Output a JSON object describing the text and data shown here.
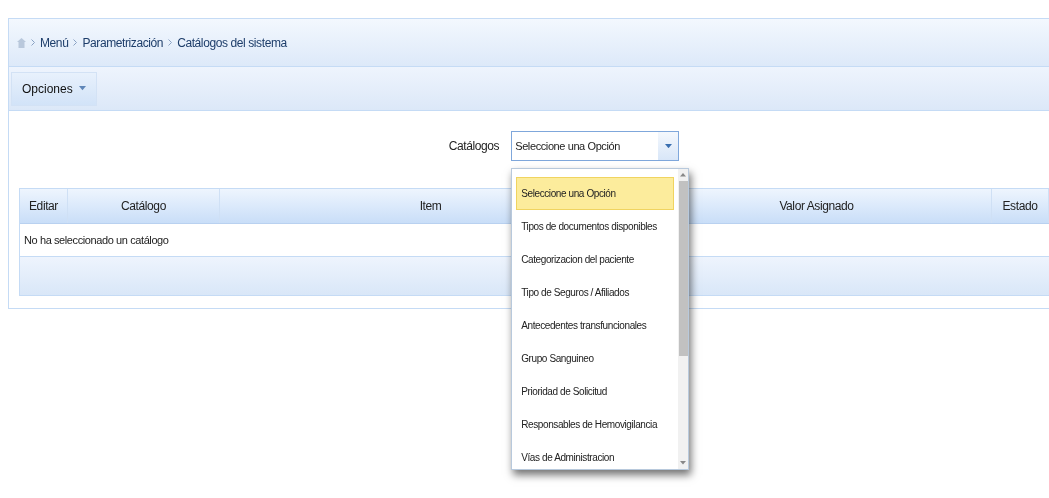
{
  "breadcrumb": [
    "Menú",
    "Parametrización",
    "Catálogos del sistema"
  ],
  "toolbar": {
    "menu_label": "Opciones"
  },
  "filter": {
    "label": "Catálogos",
    "value": "Seleccione una Opción",
    "expanded": true,
    "options": [
      {
        "label": "Seleccione una Opción",
        "selected": true
      },
      {
        "label": "Tipos de documentos disponibles",
        "selected": false
      },
      {
        "label": "Categorizacion del paciente",
        "selected": false
      },
      {
        "label": "Tipo de Seguros / Afiliados",
        "selected": false
      },
      {
        "label": "Antecedentes transfuncionales",
        "selected": false
      },
      {
        "label": "Grupo Sanguineo",
        "selected": false
      },
      {
        "label": "Prioridad de Solicitud",
        "selected": false
      },
      {
        "label": "Responsables de Hemovigilancia",
        "selected": false
      },
      {
        "label": "Vías de Administracion",
        "selected": false
      }
    ]
  },
  "table": {
    "columns": [
      "Editar",
      "Catálogo",
      "Item",
      "Valor Asignado",
      "Estado"
    ],
    "empty_message": "No ha seleccionado un catálogo"
  }
}
